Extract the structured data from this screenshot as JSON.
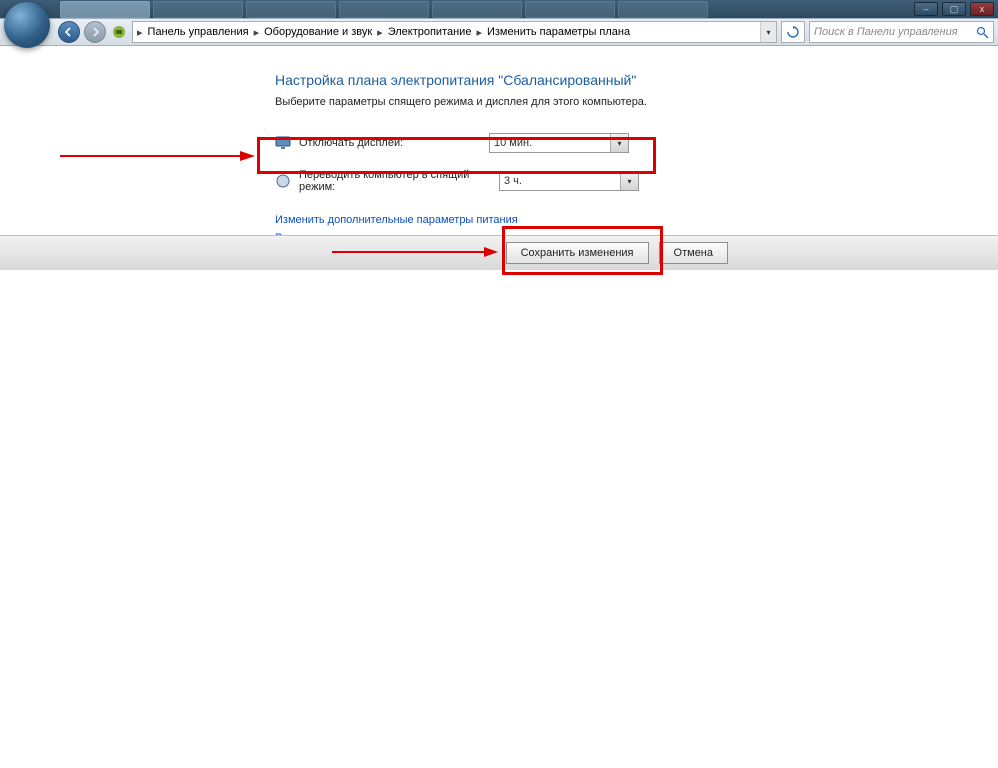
{
  "window": {
    "minimize": "–",
    "maximize": "▢",
    "close": "x"
  },
  "taskbar_tabs": [
    "",
    "",
    "",
    "",
    "",
    "",
    ""
  ],
  "breadcrumbs": {
    "items": [
      "Панель управления",
      "Оборудование и звук",
      "Электропитание",
      "Изменить параметры плана"
    ]
  },
  "search": {
    "placeholder": "Поиск в Панели управления"
  },
  "page": {
    "title": "Настройка плана электропитания \"Сбалансированный\"",
    "description": "Выберите параметры спящего режима и дисплея для этого компьютера."
  },
  "settings": {
    "display_off": {
      "label": "Отключать дисплей:",
      "value": "10 мин."
    },
    "sleep": {
      "label": "Переводить компьютер в спящий режим:",
      "value": "3 ч."
    }
  },
  "links": {
    "advanced": "Изменить дополнительные параметры питания",
    "restore": "Восстановить для плана параметры по умолчанию"
  },
  "buttons": {
    "save": "Сохранить изменения",
    "cancel": "Отмена"
  }
}
